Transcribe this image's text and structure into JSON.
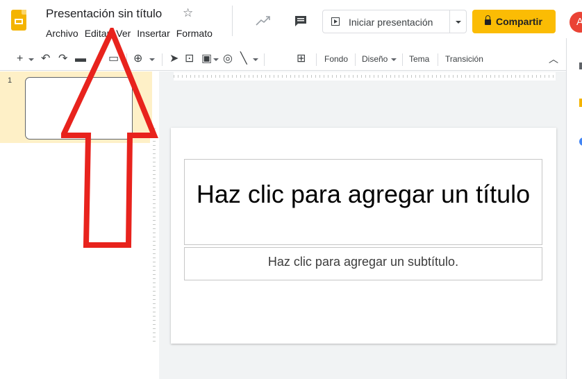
{
  "app": {
    "title": "Presentación sin título",
    "menu": [
      "Archivo",
      "Editar",
      "Ver",
      "Insertar",
      "Formato"
    ],
    "present_label": "Iniciar presentación",
    "share_label": "Compartir",
    "avatar_initial": "A"
  },
  "toolbar": {
    "fondo": "Fondo",
    "diseno": "Diseño",
    "tema": "Tema",
    "transicion": "Transición"
  },
  "filmstrip": {
    "slide_number": "1"
  },
  "slide": {
    "title_placeholder": "Haz clic para agregar un título",
    "subtitle_placeholder": "Haz clic para agregar un subtítulo."
  },
  "colors": {
    "share_button": "#fbbc04",
    "selected_slide_bg": "#fef0c7",
    "annotation_arrow": "#e8231d",
    "avatar": "#ea4335"
  }
}
